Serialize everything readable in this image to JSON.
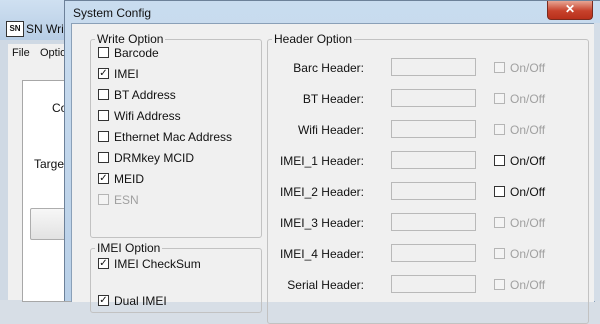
{
  "background_app": {
    "title": "SN Write",
    "icon": "app-icon",
    "menu": [
      "File",
      "Optio"
    ],
    "label_co": "Co",
    "label_targe": "Targe"
  },
  "dialog": {
    "title": "System Config",
    "close_label": "✕"
  },
  "write_option": {
    "legend": "Write Option",
    "items": [
      {
        "label": "Barcode",
        "checked": false,
        "enabled": true
      },
      {
        "label": "IMEI",
        "checked": true,
        "enabled": true
      },
      {
        "label": "BT Address",
        "checked": false,
        "enabled": true
      },
      {
        "label": "Wifi Address",
        "checked": false,
        "enabled": true
      },
      {
        "label": "Ethernet Mac Address",
        "checked": false,
        "enabled": true
      },
      {
        "label": "DRMkey MCID",
        "checked": false,
        "enabled": true
      },
      {
        "label": "MEID",
        "checked": true,
        "enabled": true
      },
      {
        "label": "ESN",
        "checked": false,
        "enabled": false
      }
    ]
  },
  "imei_option": {
    "legend": "IMEI Option",
    "items": [
      {
        "label": "IMEI CheckSum",
        "checked": true
      },
      {
        "label": "Dual IMEI",
        "checked": true
      }
    ]
  },
  "header_option": {
    "legend": "Header Option",
    "rows": [
      {
        "label": "Barc Header:",
        "value": "",
        "onoff": "On/Off",
        "enabled": false
      },
      {
        "label": "BT Header:",
        "value": "",
        "onoff": "On/Off",
        "enabled": false
      },
      {
        "label": "Wifi Header:",
        "value": "",
        "onoff": "On/Off",
        "enabled": false
      },
      {
        "label": "IMEI_1 Header:",
        "value": "",
        "onoff": "On/Off",
        "enabled": true
      },
      {
        "label": "IMEI_2 Header:",
        "value": "",
        "onoff": "On/Off",
        "enabled": true
      },
      {
        "label": "IMEI_3 Header:",
        "value": "",
        "onoff": "On/Off",
        "enabled": false
      },
      {
        "label": "IMEI_4 Header:",
        "value": "",
        "onoff": "On/Off",
        "enabled": false
      },
      {
        "label": "Serial Header:",
        "value": "",
        "onoff": "On/Off",
        "enabled": false
      }
    ]
  }
}
